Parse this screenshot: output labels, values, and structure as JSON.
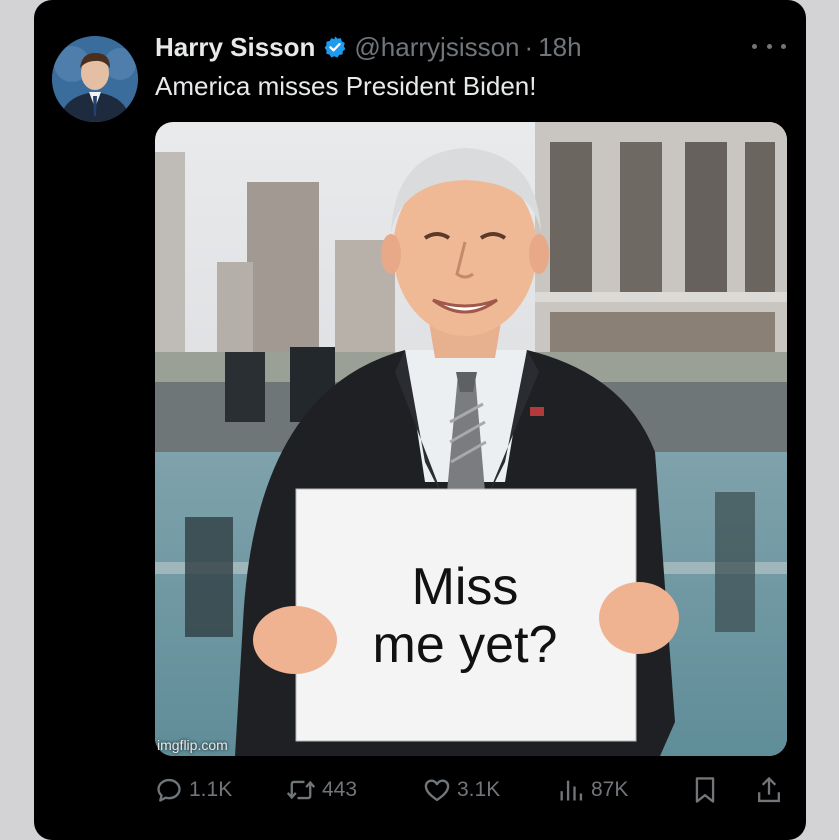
{
  "tweet": {
    "author_name": "Harry Sisson",
    "handle": "@harryjsisson",
    "separator": "·",
    "time": "18h",
    "text": "America misses President Biden!"
  },
  "media": {
    "sign_line1": "Miss",
    "sign_line2": "me yet?",
    "watermark": "imgflip.com"
  },
  "actions": {
    "replies": "1.1K",
    "reposts": "443",
    "likes": "3.1K",
    "views": "87K"
  },
  "icons": {
    "verified": "verified-badge-icon",
    "more": "more-options-icon",
    "reply": "reply-icon",
    "repost": "repost-icon",
    "like": "heart-icon",
    "views": "analytics-icon",
    "bookmark": "bookmark-icon",
    "share": "share-icon"
  },
  "colors": {
    "background": "#000000",
    "text_primary": "#e7e9ea",
    "text_secondary": "#71767b",
    "verified_blue": "#1d9bf0"
  }
}
